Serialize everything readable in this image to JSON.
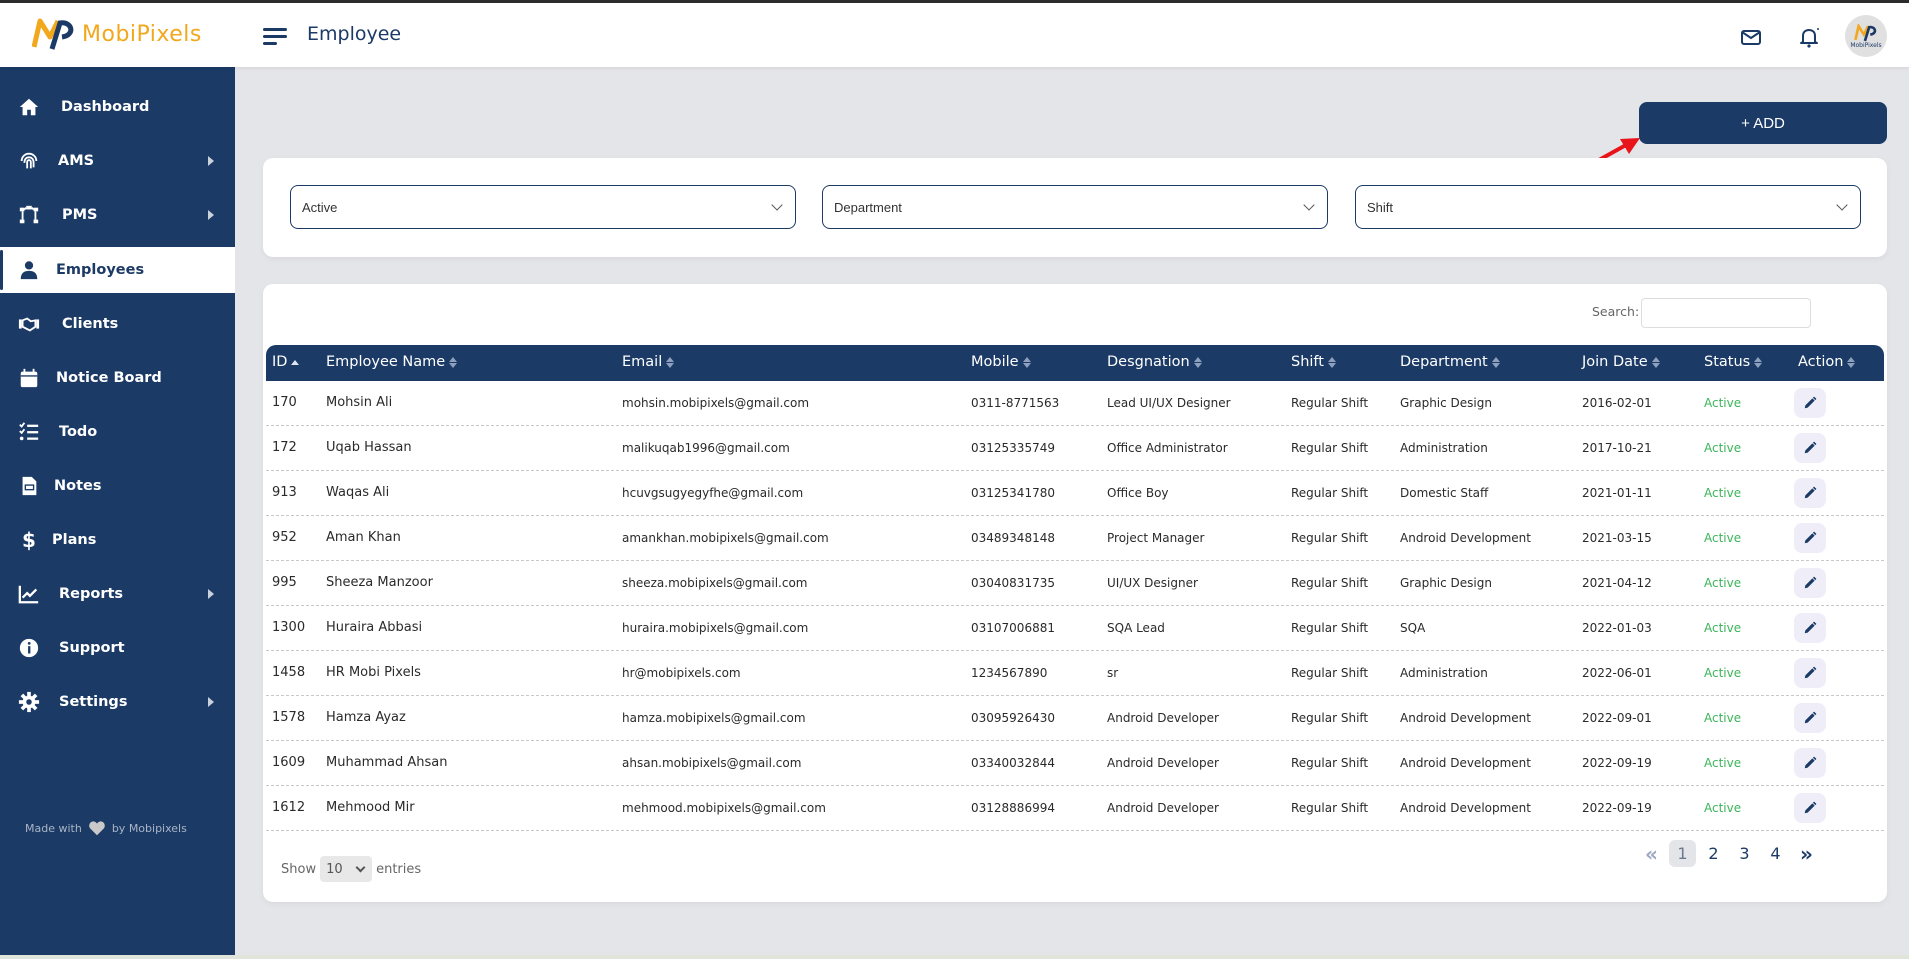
{
  "app": {
    "brand": "MobiPixels",
    "avatar_text": "MobiPixels"
  },
  "header": {
    "title": "Employee",
    "icons": [
      "mail-icon",
      "bell-icon"
    ]
  },
  "sidebar": {
    "items": [
      {
        "label": "Dashboard",
        "icon": "home-icon",
        "submenu": false,
        "active": false
      },
      {
        "label": "AMS",
        "icon": "fingerprint-icon",
        "submenu": true,
        "active": false
      },
      {
        "label": "PMS",
        "icon": "project-diagram-icon",
        "submenu": true,
        "active": false
      },
      {
        "label": "Employees",
        "icon": "user-icon",
        "submenu": false,
        "active": true
      },
      {
        "label": "Clients",
        "icon": "handshake-icon",
        "submenu": false,
        "active": false
      },
      {
        "label": "Notice Board",
        "icon": "calendar-icon",
        "submenu": false,
        "active": false
      },
      {
        "label": "Todo",
        "icon": "checklist-icon",
        "submenu": false,
        "active": false
      },
      {
        "label": "Notes",
        "icon": "file-icon",
        "submenu": false,
        "active": false
      },
      {
        "label": "Plans",
        "icon": "dollar-icon",
        "submenu": false,
        "active": false
      },
      {
        "label": "Reports",
        "icon": "chart-line-icon",
        "submenu": true,
        "active": false
      },
      {
        "label": "Support",
        "icon": "info-icon",
        "submenu": false,
        "active": false
      },
      {
        "label": "Settings",
        "icon": "gear-icon",
        "submenu": true,
        "active": false
      }
    ],
    "footer": {
      "made_with": "Made with",
      "by": "by Mobipixels"
    }
  },
  "toolbar": {
    "add_label": "+ ADD"
  },
  "filters": {
    "status": "Active",
    "department": "Department",
    "shift": "Shift"
  },
  "table": {
    "search_label": "Search:",
    "search_value": "",
    "columns": [
      "ID",
      "Employee Name",
      "Email",
      "Mobile",
      "Desgnation",
      "Shift",
      "Department",
      "Join Date",
      "Status",
      "Action"
    ],
    "sorted_column": "ID",
    "rows": [
      {
        "id": "170",
        "name": "Mohsin Ali",
        "email": "mohsin.mobipixels@gmail.com",
        "mobile": "0311-8771563",
        "designation": "Lead UI/UX Designer",
        "shift": "Regular Shift",
        "department": "Graphic Design",
        "join_date": "2016-02-01",
        "status": "Active"
      },
      {
        "id": "172",
        "name": "Uqab Hassan",
        "email": "malikuqab1996@gmail.com",
        "mobile": "03125335749",
        "designation": "Office Administrator",
        "shift": "Regular Shift",
        "department": "Administration",
        "join_date": "2017-10-21",
        "status": "Active"
      },
      {
        "id": "913",
        "name": "Waqas Ali",
        "email": "hcuvgsugyegyfhe@gmail.com",
        "mobile": "03125341780",
        "designation": "Office Boy",
        "shift": "Regular Shift",
        "department": "Domestic Staff",
        "join_date": "2021-01-11",
        "status": "Active"
      },
      {
        "id": "952",
        "name": "Aman Khan",
        "email": "amankhan.mobipixels@gmail.com",
        "mobile": "03489348148",
        "designation": "Project Manager",
        "shift": "Regular Shift",
        "department": "Android Development",
        "join_date": "2021-03-15",
        "status": "Active"
      },
      {
        "id": "995",
        "name": "Sheeza Manzoor",
        "email": "sheeza.mobipixels@gmail.com",
        "mobile": "03040831735",
        "designation": "UI/UX Designer",
        "shift": "Regular Shift",
        "department": "Graphic Design",
        "join_date": "2021-04-12",
        "status": "Active"
      },
      {
        "id": "1300",
        "name": "Huraira Abbasi",
        "email": "huraira.mobipixels@gmail.com",
        "mobile": "03107006881",
        "designation": "SQA Lead",
        "shift": "Regular Shift",
        "department": "SQA",
        "join_date": "2022-01-03",
        "status": "Active"
      },
      {
        "id": "1458",
        "name": "HR Mobi Pixels",
        "email": "hr@mobipixels.com",
        "mobile": "1234567890",
        "designation": "sr",
        "shift": "Regular Shift",
        "department": "Administration",
        "join_date": "2022-06-01",
        "status": "Active"
      },
      {
        "id": "1578",
        "name": "Hamza Ayaz",
        "email": "hamza.mobipixels@gmail.com",
        "mobile": "03095926430",
        "designation": "Android Developer",
        "shift": "Regular Shift",
        "department": "Android Development",
        "join_date": "2022-09-01",
        "status": "Active"
      },
      {
        "id": "1609",
        "name": "Muhammad Ahsan",
        "email": "ahsan.mobipixels@gmail.com",
        "mobile": "03340032844",
        "designation": "Android Developer",
        "shift": "Regular Shift",
        "department": "Android Development",
        "join_date": "2022-09-19",
        "status": "Active"
      },
      {
        "id": "1612",
        "name": "Mehmood Mir",
        "email": "mehmood.mobipixels@gmail.com",
        "mobile": "03128886994",
        "designation": "Android Developer",
        "shift": "Regular Shift",
        "department": "Android Development",
        "join_date": "2022-09-19",
        "status": "Active"
      }
    ],
    "show_label": "Show",
    "entries_label": "entries",
    "page_size": "10",
    "pagination": {
      "pages": [
        "1",
        "2",
        "3",
        "4"
      ],
      "current": "1",
      "prev": "«",
      "next": "»"
    }
  },
  "colors": {
    "primary": "#1b3a66",
    "accent": "#f2a81d",
    "status_active": "#3cb55a",
    "background": "#e4e5e9"
  }
}
